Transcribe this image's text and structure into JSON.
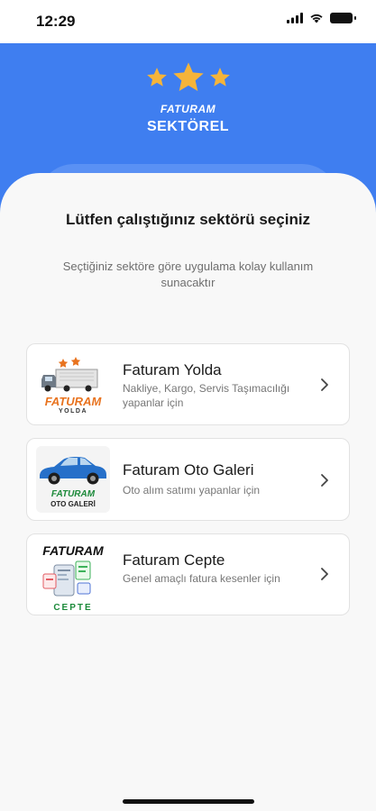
{
  "status_bar": {
    "time": "12:29",
    "icons": [
      "signal-icon",
      "wifi-icon",
      "battery-icon"
    ]
  },
  "header": {
    "brand_small": "FATURAM",
    "brand_big": "SEKTÖREL",
    "icon": "three-stars-icon",
    "background_color": "#3f7ef0",
    "star_color": "#f5b43a"
  },
  "sheet": {
    "title": "Lütfen çalıştığınız sektörü seçiniz",
    "subtitle": "Seçtiğiniz sektöre göre uygulama kolay kullanım sunacaktır"
  },
  "sectors": [
    {
      "title": "Faturam Yolda",
      "description": "Nakliye, Kargo, Servis Taşımacılığı yapanlar için",
      "logo_brand": "FATURAM",
      "logo_caption": "YOLDA",
      "logo_icon": "truck-icon",
      "logo_color": "#e8731f"
    },
    {
      "title": "Faturam Oto Galeri",
      "description": "Oto alım satımı yapanlar için",
      "logo_brand": "FATURAM",
      "logo_caption": "OTO GALERİ",
      "logo_icon": "car-icon",
      "logo_color": "#1c8a3a"
    },
    {
      "title": "Faturam Cepte",
      "description": "Genel amaçlı fatura kesenler için",
      "logo_brand": "FATURAM",
      "logo_caption": "CEPTE",
      "logo_icon": "phone-invoice-icon",
      "logo_color": "#1c8a3a"
    }
  ]
}
